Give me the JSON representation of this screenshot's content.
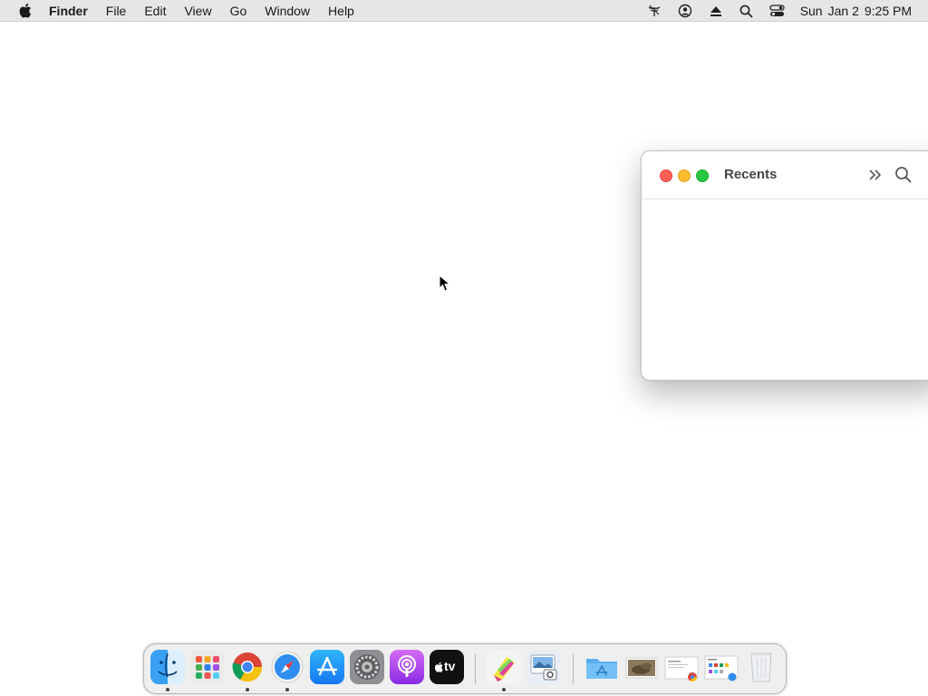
{
  "menubar": {
    "app_name": "Finder",
    "items": [
      "File",
      "Edit",
      "View",
      "Go",
      "Window",
      "Help"
    ],
    "clock": {
      "day": "Sun",
      "date": "Jan 2",
      "time": "9:25 PM"
    }
  },
  "window": {
    "title": "Recents"
  },
  "dock": {
    "apps": [
      {
        "name": "finder-icon",
        "running": true
      },
      {
        "name": "launchpad-icon",
        "running": false
      },
      {
        "name": "chrome-icon",
        "running": true
      },
      {
        "name": "safari-icon",
        "running": true
      },
      {
        "name": "app-store-icon",
        "running": false
      },
      {
        "name": "system-preferences-icon",
        "running": false
      },
      {
        "name": "podcasts-icon",
        "running": false
      },
      {
        "name": "apple-tv-icon",
        "running": false
      },
      {
        "name": "highlighter-app-icon",
        "running": true
      },
      {
        "name": "preview-app-icon",
        "running": false
      },
      {
        "name": "applications-folder-icon",
        "running": false
      },
      {
        "name": "photo-stack-icon",
        "running": false
      },
      {
        "name": "document-stack-icon",
        "running": false
      },
      {
        "name": "screenshot-stack-icon",
        "running": false
      },
      {
        "name": "trash-icon",
        "running": false
      }
    ],
    "tv_label": "tv"
  },
  "colors": {
    "menubar_bg": "#e6e6e6",
    "close": "#ff5f57",
    "minimize": "#febc2e",
    "maximize": "#28c840"
  }
}
